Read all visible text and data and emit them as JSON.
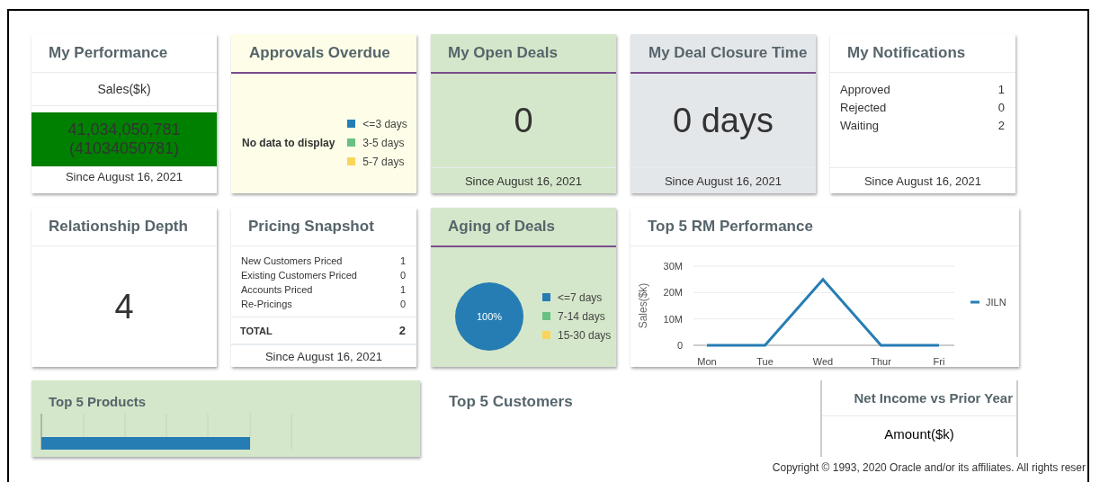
{
  "cards": [
    {
      "kind": "amount",
      "title": "My Performance",
      "label": "Sales($k)",
      "value": "41,034,050,781",
      "raw": "(41034050781)",
      "footer": "Since August 16, 2021"
    },
    {
      "kind": "no-data",
      "title": "Approvals Overdue",
      "message": "No data to display",
      "legend": [
        {
          "label": "<=3 days",
          "color": "#267db3"
        },
        {
          "label": "3-5 days",
          "color": "#68c182"
        },
        {
          "label": "5-7 days",
          "color": "#fad55c"
        }
      ]
    },
    {
      "kind": "big",
      "title": "My Open Deals",
      "value": "0",
      "footer": "Since August 16, 2021"
    },
    {
      "kind": "big",
      "title": "My Deal Closure Time",
      "value": "0 days",
      "footer": "Since August 16, 2021"
    },
    {
      "kind": "list",
      "title": "My Notifications",
      "rows": [
        {
          "label": "Approved",
          "value": "1"
        },
        {
          "label": "Rejected",
          "value": "0"
        },
        {
          "label": "Waiting",
          "value": "2"
        }
      ],
      "footer": "Since August 16, 2021"
    },
    {
      "kind": "big",
      "title": "Relationship Depth",
      "value": "4"
    },
    {
      "kind": "list",
      "title": "Pricing Snapshot",
      "rows": [
        {
          "label": "New Customers Priced",
          "value": "1"
        },
        {
          "label": "Existing Customers Priced",
          "value": "0"
        },
        {
          "label": "Accounts Priced",
          "value": "1"
        },
        {
          "label": "Re-Pricings",
          "value": "0"
        }
      ],
      "total": {
        "label": "TOTAL",
        "value": "2"
      },
      "footer": "Since August 16, 2021"
    },
    {
      "kind": "chart",
      "title": "Aging of Deals",
      "chart_data": {
        "type": "pie",
        "categories": [
          "<=7 days",
          "7-14 days",
          "15-30 days"
        ],
        "values": [
          100,
          0,
          0
        ],
        "colors": [
          "#267db3",
          "#68c182",
          "#fad55c"
        ],
        "value_labels": [
          "100%",
          null,
          null
        ]
      }
    },
    {
      "kind": "chart",
      "title": "Top 5 RM Performance",
      "chart_data": {
        "type": "line",
        "categories": [
          "Mon",
          "Tue",
          "Wed",
          "Thur",
          "Fri"
        ],
        "ylabel": "Sales($k)",
        "ylim": [
          0,
          30000000
        ],
        "yticks": [
          {
            "value": 0,
            "label": "0"
          },
          {
            "value": 10000000,
            "label": "10M"
          },
          {
            "value": 20000000,
            "label": "20M"
          },
          {
            "value": 30000000,
            "label": "30M"
          }
        ],
        "series": [
          {
            "name": "JILN",
            "color": "#267db3",
            "values": [
              0,
              0,
              25000000,
              0,
              0
            ]
          }
        ]
      }
    }
  ],
  "bottom_cards": [
    {
      "kind": "bars",
      "title": "Top 5 Products"
    },
    {
      "kind": "empty",
      "title": "Top 5 Customers"
    },
    {
      "kind": "amount-label",
      "title": "Net Income vs Prior Year",
      "label": "Amount($k)"
    }
  ],
  "copyright": "Copyright © 1993, 2020 Oracle and/or its affiliates. All rights reser"
}
